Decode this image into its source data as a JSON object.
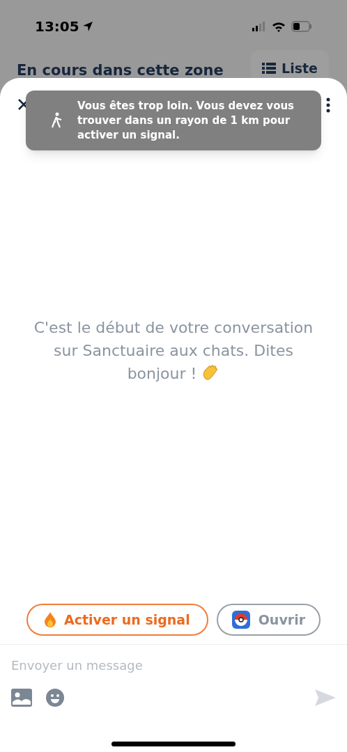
{
  "status_bar": {
    "time": "13:05"
  },
  "background": {
    "title": "En cours dans cette zone",
    "list_button": "Liste"
  },
  "toast": {
    "message": "Vous êtes trop loin. Vous devez vous trouver dans un rayon de 1 km pour activer un signal."
  },
  "chat": {
    "empty_message": "C'est le début de votre conversation sur Sanctuaire aux chats. Dites bonjour !"
  },
  "actions": [
    {
      "kind": "signal",
      "label": "Activer un signal"
    },
    {
      "kind": "open",
      "label": "Ouvrir"
    }
  ],
  "composer": {
    "placeholder": "Envoyer un message"
  }
}
